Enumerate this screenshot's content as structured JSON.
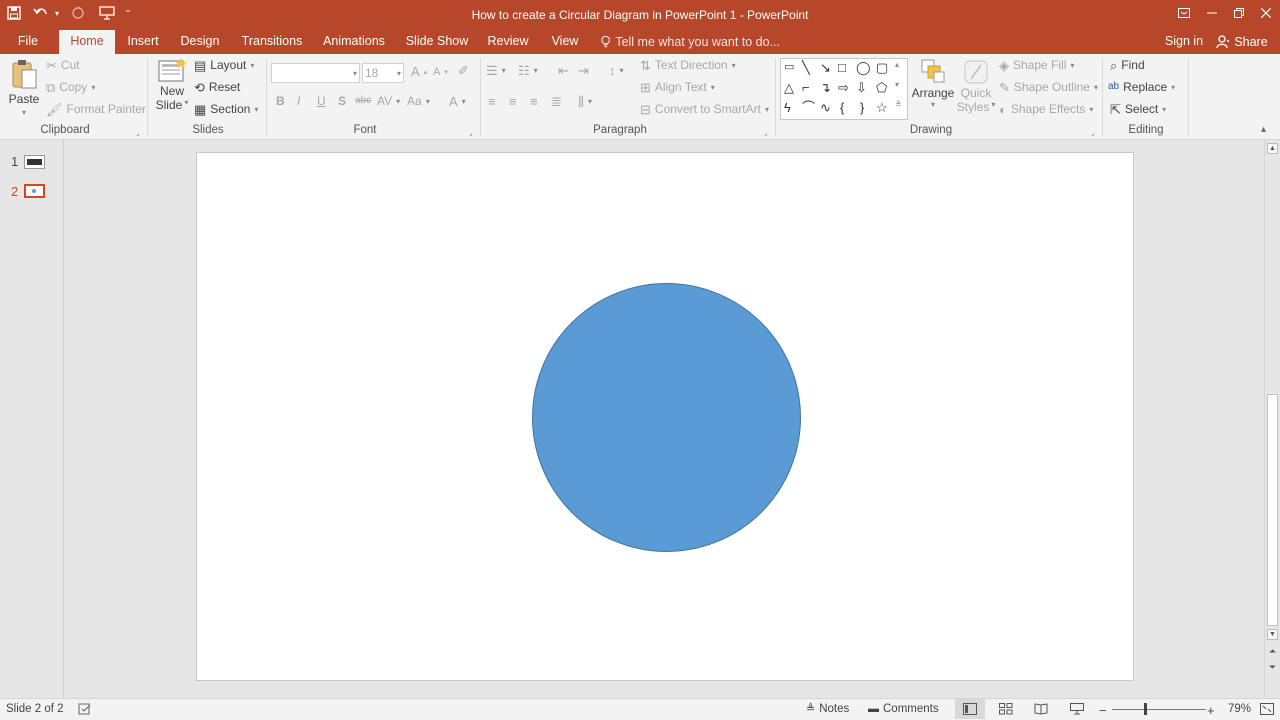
{
  "window": {
    "title": "How to create a Circular Diagram in PowerPoint 1 - PowerPoint"
  },
  "qat": {
    "save_icon": "save-icon",
    "undo_icon": "undo-icon",
    "redo_icon": "redo-icon",
    "present_icon": "present-from-start-icon",
    "customize_icon": "customize-qat-icon"
  },
  "tabs": {
    "file": "File",
    "home": "Home",
    "insert": "Insert",
    "design": "Design",
    "transitions": "Transitions",
    "animations": "Animations",
    "slideshow": "Slide Show",
    "review": "Review",
    "view": "View",
    "tellme": "Tell me what you want to do...",
    "signin": "Sign in",
    "share": "Share"
  },
  "clipboard": {
    "paste": "Paste",
    "cut": "Cut",
    "copy": "Copy",
    "format_painter": "Format Painter",
    "label": "Clipboard"
  },
  "slides": {
    "new_slide_1": "New",
    "new_slide_2": "Slide",
    "layout": "Layout",
    "reset": "Reset",
    "section": "Section",
    "label": "Slides"
  },
  "font": {
    "family_value": "",
    "size_value": "18",
    "bold": "B",
    "italic": "I",
    "underline": "U",
    "shadow": "S",
    "strike": "abc",
    "spacing": "AV",
    "case": "Aa",
    "color": "A",
    "grow": "A",
    "shrink": "A",
    "label": "Font"
  },
  "paragraph": {
    "text_direction": "Text Direction",
    "align_text": "Align Text",
    "convert_smartart": "Convert to SmartArt",
    "label": "Paragraph"
  },
  "drawing": {
    "arrange": "Arrange",
    "quick_styles_1": "Quick",
    "quick_styles_2": "Styles",
    "shape_fill": "Shape Fill",
    "shape_outline": "Shape Outline",
    "shape_effects": "Shape Effects",
    "label": "Drawing"
  },
  "editing": {
    "find": "Find",
    "replace": "Replace",
    "select": "Select",
    "label": "Editing"
  },
  "slide_pane": {
    "slide1_num": "1",
    "slide2_num": "2"
  },
  "canvas": {
    "shape_fill": "#5b9bd5",
    "shape_outline": "#41719c"
  },
  "status": {
    "slide_info": "Slide 2 of 2",
    "notes": "Notes",
    "comments": "Comments",
    "zoom": "79%"
  },
  "colors": {
    "accent": "#b7472a",
    "ribbon_bg": "#f3f3f3"
  }
}
